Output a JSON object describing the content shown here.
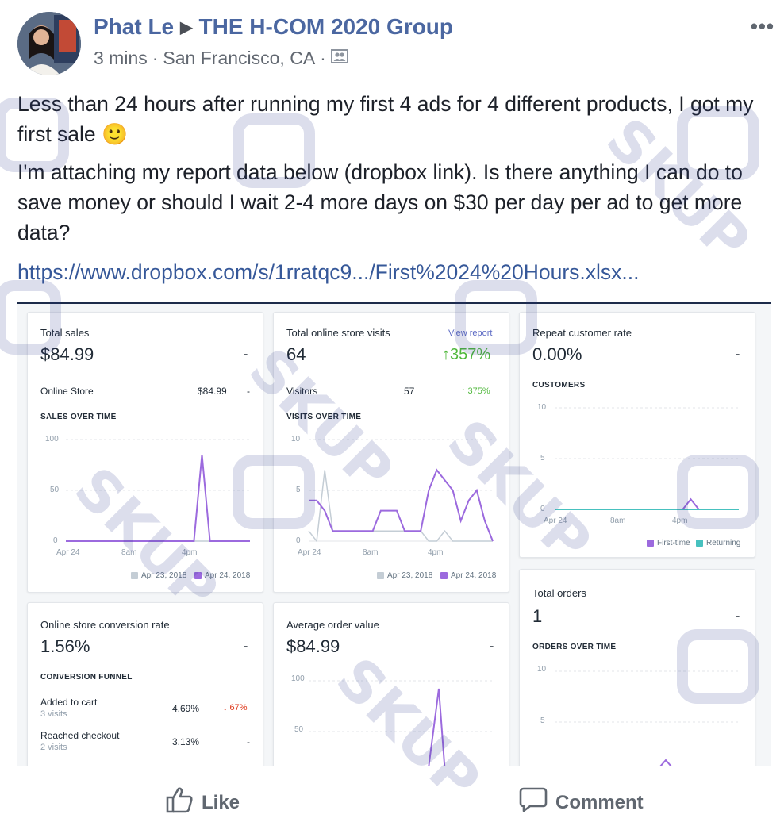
{
  "post": {
    "author": "Phat Le",
    "group": "THE H-COM 2020 Group",
    "time": "3 mins",
    "location": "San Francisco, CA",
    "paragraph1": "Less than 24 hours after running my first 4 ads for 4 different products, I got my first sale 🙂",
    "paragraph2": "I'm attaching my report data below (dropbox link). Is there anything I can do to save money or should I wait 2-4 more days on $30 per day per ad to get more data?",
    "link": "https://www.dropbox.com/s/1rratqc9.../First%2024%20Hours.xlsx..."
  },
  "report": {
    "total_sales": {
      "title": "Total sales",
      "value": "$84.99",
      "dash": "-",
      "row_label": "Online Store",
      "row_value": "$84.99",
      "row_dash": "-",
      "section": "SALES OVER TIME",
      "y_ticks": [
        "100",
        "50",
        "0"
      ],
      "x_ticks": [
        "Apr 24",
        "8am",
        "4pm"
      ],
      "legend_prev": "Apr 23, 2018",
      "legend_curr": "Apr 24, 2018"
    },
    "visits": {
      "title": "Total online store visits",
      "value": "64",
      "link": "View report",
      "change": "↑357%",
      "row_label": "Visitors",
      "row_value": "57",
      "row_change": "↑ 375%",
      "section": "VISITS OVER TIME",
      "y_ticks": [
        "10",
        "5",
        "0"
      ],
      "x_ticks": [
        "Apr 24",
        "8am",
        "4pm"
      ],
      "legend_prev": "Apr 23, 2018",
      "legend_curr": "Apr 24, 2018"
    },
    "repeat": {
      "title": "Repeat customer rate",
      "value": "0.00%",
      "dash": "-",
      "section": "CUSTOMERS",
      "y_ticks": [
        "10",
        "5",
        "0"
      ],
      "x_ticks": [
        "Apr 24",
        "8am",
        "4pm"
      ],
      "legend_first": "First-time",
      "legend_returning": "Returning"
    },
    "conversion": {
      "title": "Online store conversion rate",
      "value": "1.56%",
      "dash": "-",
      "section": "CONVERSION FUNNEL",
      "rows": [
        {
          "label": "Added to cart",
          "sub": "3 visits",
          "value": "4.69%",
          "change": "↓ 67%"
        },
        {
          "label": "Reached checkout",
          "sub": "2 visits",
          "value": "3.13%",
          "change": "-"
        }
      ]
    },
    "aov": {
      "title": "Average order value",
      "value": "$84.99",
      "dash": "-",
      "y_ticks": [
        "100",
        "50"
      ]
    },
    "orders": {
      "title": "Total orders",
      "value": "1",
      "dash": "-",
      "section": "ORDERS OVER TIME",
      "y_ticks": [
        "10",
        "5"
      ]
    }
  },
  "chart_data": [
    {
      "type": "line",
      "title": "SALES OVER TIME",
      "x_ticks": [
        "Apr 24",
        "8am",
        "4pm"
      ],
      "ylim": [
        0,
        100
      ],
      "series": [
        {
          "name": "Apr 23, 2018",
          "values": [
            0,
            0,
            0,
            0,
            0,
            0,
            0,
            0,
            0,
            0,
            0,
            0,
            0,
            0,
            0,
            0,
            0,
            0,
            0,
            0,
            0,
            0,
            0,
            0
          ]
        },
        {
          "name": "Apr 24, 2018",
          "values": [
            0,
            0,
            0,
            0,
            0,
            0,
            0,
            0,
            0,
            0,
            0,
            0,
            0,
            0,
            0,
            0,
            0,
            85,
            0,
            0,
            0,
            0,
            0,
            0
          ]
        }
      ]
    },
    {
      "type": "line",
      "title": "VISITS OVER TIME",
      "x_ticks": [
        "Apr 24",
        "8am",
        "4pm"
      ],
      "ylim": [
        0,
        10
      ],
      "series": [
        {
          "name": "Apr 23, 2018",
          "values": [
            1,
            0,
            7,
            1,
            1,
            1,
            1,
            1,
            1,
            1,
            1,
            1,
            1,
            1,
            1,
            0,
            0,
            1,
            0,
            0,
            0,
            0,
            0,
            0
          ]
        },
        {
          "name": "Apr 24, 2018",
          "values": [
            4,
            4,
            3,
            1,
            1,
            1,
            1,
            1,
            1,
            3,
            3,
            3,
            1,
            1,
            1,
            5,
            7,
            6,
            5,
            2,
            4,
            5,
            2,
            0
          ]
        }
      ]
    },
    {
      "type": "line",
      "title": "CUSTOMERS",
      "x_ticks": [
        "Apr 24",
        "8am",
        "4pm"
      ],
      "ylim": [
        0,
        10
      ],
      "series": [
        {
          "name": "First-time",
          "values": [
            0,
            0,
            0,
            0,
            0,
            0,
            0,
            0,
            0,
            0,
            0,
            0,
            0,
            0,
            0,
            0,
            0,
            1,
            0,
            0,
            0,
            0,
            0,
            0
          ]
        },
        {
          "name": "Returning",
          "values": [
            0,
            0,
            0,
            0,
            0,
            0,
            0,
            0,
            0,
            0,
            0,
            0,
            0,
            0,
            0,
            0,
            0,
            0,
            0,
            0,
            0,
            0,
            0,
            0
          ]
        }
      ]
    }
  ],
  "actions": {
    "like": "Like",
    "comment": "Comment"
  },
  "watermark": "SKUP"
}
